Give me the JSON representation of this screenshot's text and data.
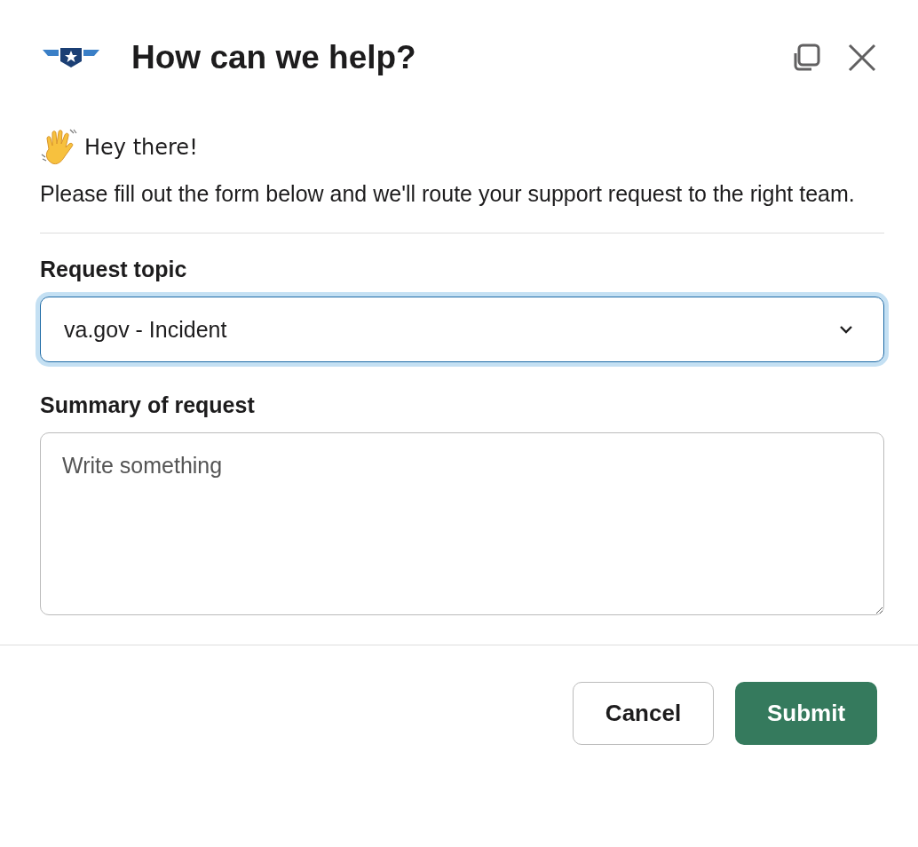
{
  "dialog": {
    "title": "How can we help?"
  },
  "greeting": "Hey there!",
  "intro": "Please fill out the form below and we'll route your support request to the right team.",
  "fields": [
    {
      "kind": "select",
      "label": "Request topic",
      "value": "va.gov - Incident",
      "focused": true
    },
    {
      "kind": "textarea",
      "label": "Summary of request",
      "placeholder": "Write something",
      "focused": false
    }
  ],
  "buttons": [
    {
      "label": "Cancel",
      "primary": false
    },
    {
      "label": "Submit",
      "primary": true
    }
  ]
}
